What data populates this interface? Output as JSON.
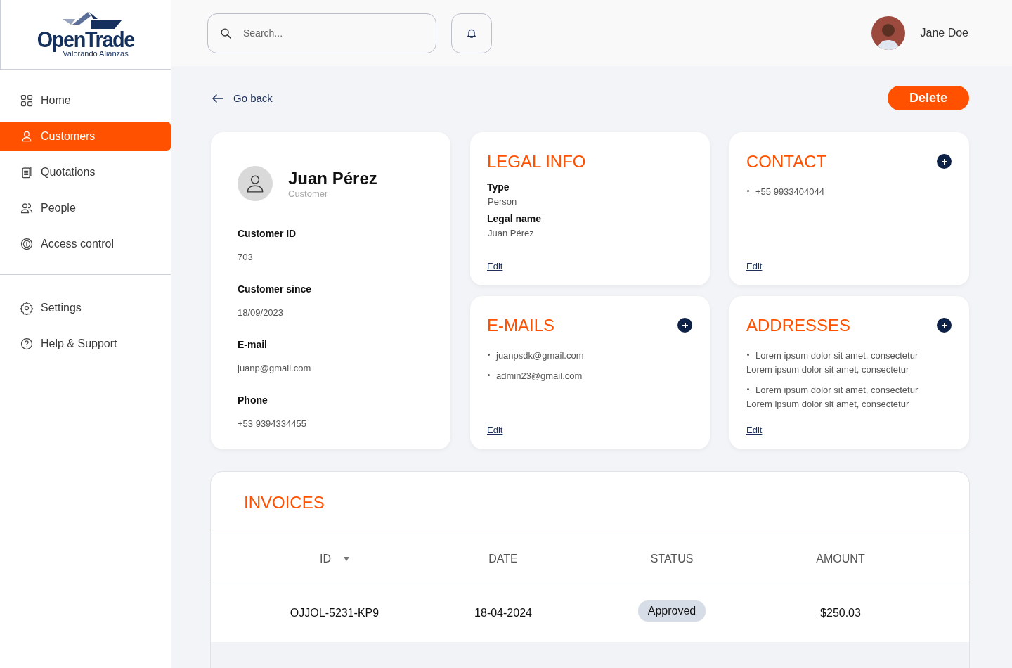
{
  "sidebar": {
    "logo": {
      "name": "OpenTrade",
      "tagline": "Valorando Alianzas"
    },
    "items": [
      {
        "label": "Home",
        "kind": "grid",
        "selected": false
      },
      {
        "label": "Customers",
        "kind": "user",
        "selected": true
      },
      {
        "label": "Quotations",
        "kind": "document",
        "selected": false
      },
      {
        "label": "People",
        "kind": "users",
        "selected": false
      },
      {
        "label": "Access control",
        "kind": "fingerprint",
        "selected": false
      }
    ],
    "footer_items": [
      {
        "label": "Settings",
        "kind": "gear",
        "selected": false
      },
      {
        "label": "Help & Support",
        "kind": "help",
        "selected": false
      }
    ]
  },
  "header": {
    "search": {
      "placeholder": "Search..."
    },
    "user": {
      "name": "Jane Doe"
    }
  },
  "back_link": "Go back",
  "delete_button": "Delete",
  "profile": {
    "name": "Juan Pérez",
    "role": "Customer",
    "fields": [
      {
        "label": "Customer ID",
        "value": "703"
      },
      {
        "label": "Customer since",
        "value": "18/09/2023"
      },
      {
        "label": "E-mail",
        "value": "juanp@gmail.com"
      },
      {
        "label": "Phone",
        "value": "+53 9394334455"
      }
    ]
  },
  "cards": [
    {
      "title": "LEGAL INFO",
      "kind": "fields",
      "can_add": false,
      "fields": [
        {
          "label": "Type",
          "value": "Person"
        },
        {
          "label": "Legal name",
          "value": "Juan Pérez"
        }
      ],
      "edit": "Edit"
    },
    {
      "title": "CONTACT",
      "kind": "list",
      "can_add": true,
      "items": [
        {
          "lines": [
            "+55 9933404044"
          ]
        }
      ],
      "edit": "Edit"
    },
    {
      "title": "E-MAILS",
      "kind": "list",
      "can_add": true,
      "items": [
        {
          "lines": [
            "juanpsdk@gmail.com"
          ]
        },
        {
          "lines": [
            "admin23@gmail.com"
          ]
        }
      ],
      "edit": "Edit"
    },
    {
      "title": "ADDRESSES",
      "kind": "list",
      "can_add": true,
      "items": [
        {
          "lines": [
            "Lorem ipsum dolor sit amet, consectetur",
            "Lorem ipsum dolor sit amet, consectetur"
          ]
        },
        {
          "lines": [
            "Lorem ipsum dolor sit amet, consectetur",
            "Lorem ipsum dolor sit amet, consectetur"
          ]
        }
      ],
      "edit": "Edit"
    }
  ],
  "invoices": {
    "title": "INVOICES",
    "columns": [
      {
        "label": "ID",
        "sorted": true
      },
      {
        "label": "DATE",
        "sorted": false
      },
      {
        "label": "STATUS",
        "sorted": false
      },
      {
        "label": "AMOUNT",
        "sorted": false
      }
    ],
    "rows": [
      {
        "id": "OJJOL-5231-KP9",
        "date": "18-04-2024",
        "status": "Approved",
        "amount": "$250.03"
      }
    ]
  }
}
